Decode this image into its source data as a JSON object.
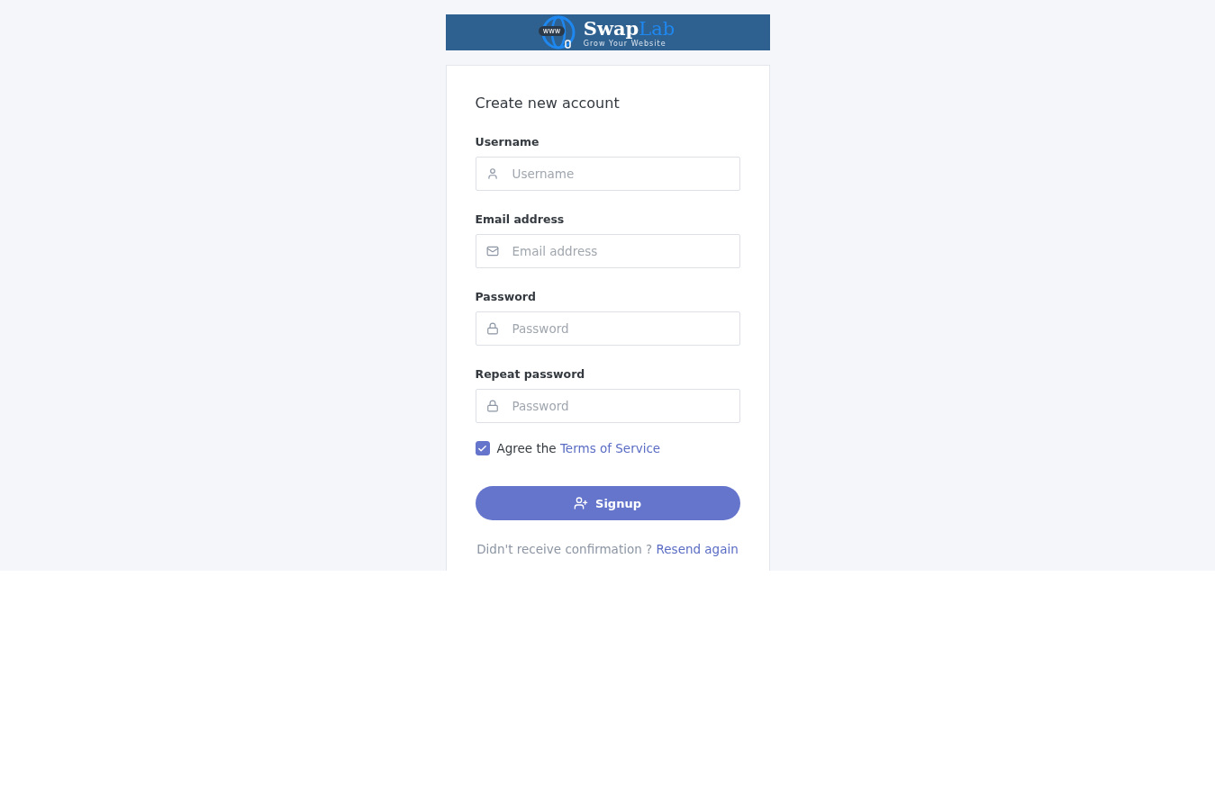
{
  "logo": {
    "badge": "www",
    "name_part_1": "Swap",
    "name_part_2": "Lab",
    "tagline": "Grow Your Website"
  },
  "form": {
    "title": "Create new account",
    "fields": [
      {
        "label": "Username",
        "placeholder": "Username",
        "kind": "user"
      },
      {
        "label": "Email address",
        "placeholder": "Email address",
        "kind": "email"
      },
      {
        "label": "Password",
        "placeholder": "Password",
        "kind": "password"
      },
      {
        "label": "Repeat password",
        "placeholder": "Password",
        "kind": "password"
      }
    ],
    "agree": {
      "text": "Agree the",
      "link": "Terms of Service",
      "checked": true
    },
    "submit": "Signup",
    "footer": {
      "text": "Didn't receive confirmation ?",
      "link": "Resend again"
    }
  }
}
